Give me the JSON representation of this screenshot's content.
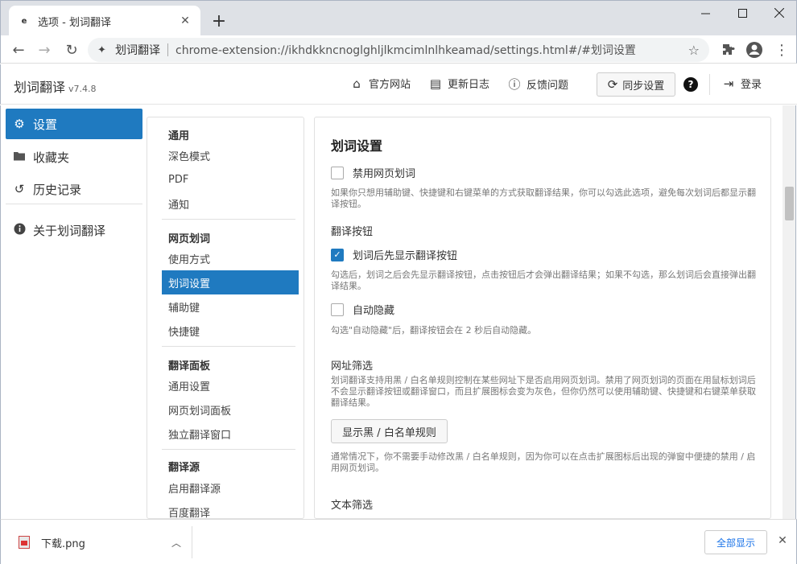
{
  "browser": {
    "tab_title": "选项 - 划词翻译",
    "tab_favicon_text": "e",
    "omnibox_site": "划词翻译",
    "omnibox_url": "chrome-extension://ikhdkkncnoglghljlkmcimlnlhkeamad/settings.html#/#划词设置"
  },
  "header": {
    "app_title": "划词翻译",
    "version": "v7.4.8",
    "links": {
      "site": "官方网站",
      "changelog": "更新日志",
      "feedback": "反馈问题",
      "sync": "同步设置",
      "help": "?",
      "login": "登录"
    }
  },
  "sidebar": {
    "items": [
      {
        "label": "设置",
        "icon": "gear-icon"
      },
      {
        "label": "收藏夹",
        "icon": "folder-icon"
      },
      {
        "label": "历史记录",
        "icon": "history-icon"
      },
      {
        "label": "关于划词翻译",
        "icon": "info-icon"
      }
    ]
  },
  "midnav": {
    "groups": [
      {
        "title": "通用",
        "items": [
          "深色模式",
          "PDF",
          "通知"
        ]
      },
      {
        "title": "网页划词",
        "items": [
          "使用方式",
          "划词设置",
          "辅助键",
          "快捷键"
        ]
      },
      {
        "title": "翻译面板",
        "items": [
          "通用设置",
          "网页划词面板",
          "独立翻译窗口"
        ]
      },
      {
        "title": "翻译源",
        "items": [
          "启用翻译源",
          "百度翻译"
        ]
      }
    ],
    "active_item": "划词设置"
  },
  "main": {
    "title": "划词设置",
    "disable_web": {
      "label": "禁用网页划词",
      "checked": false,
      "desc": "如果你只想用辅助键、快捷键和右键菜单的方式获取翻译结果，你可以勾选此选项，避免每次划词后都显示翻译按钮。"
    },
    "button_section_title": "翻译按钮",
    "show_button_first": {
      "label": "划词后先显示翻译按钮",
      "checked": true,
      "desc": "勾选后，划词之后会先显示翻译按钮，点击按钮后才会弹出翻译结果；如果不勾选，那么划词后会直接弹出翻译结果。"
    },
    "auto_hide": {
      "label": "自动隐藏",
      "checked": false,
      "desc": "勾选\"自动隐藏\"后，翻译按钮会在 2 秒后自动隐藏。"
    },
    "url_filter": {
      "title": "网址筛选",
      "desc": "划词翻译支持用黑 / 白名单规则控制在某些网址下是否启用网页划词。禁用了网页划词的页面在用鼠标划词后不会显示翻译按钮或翻译窗口，而且扩展图标会变为灰色，但你仍然可以使用辅助键、快捷键和右键菜单获取翻译结果。",
      "button": "显示黑 / 白名单规则",
      "note": "通常情况下，你不需要手动修改黑 / 白名单规则，因为你可以在点击扩展图标后出现的弹窗中便捷的禁用 / 启用网页划词。"
    },
    "text_filter_title": "文本筛选"
  },
  "downloads": {
    "file_name": "下载.png",
    "show_all": "全部显示"
  },
  "colors": {
    "accent": "#1f7ac0",
    "titlebar": "#dee1e6"
  }
}
